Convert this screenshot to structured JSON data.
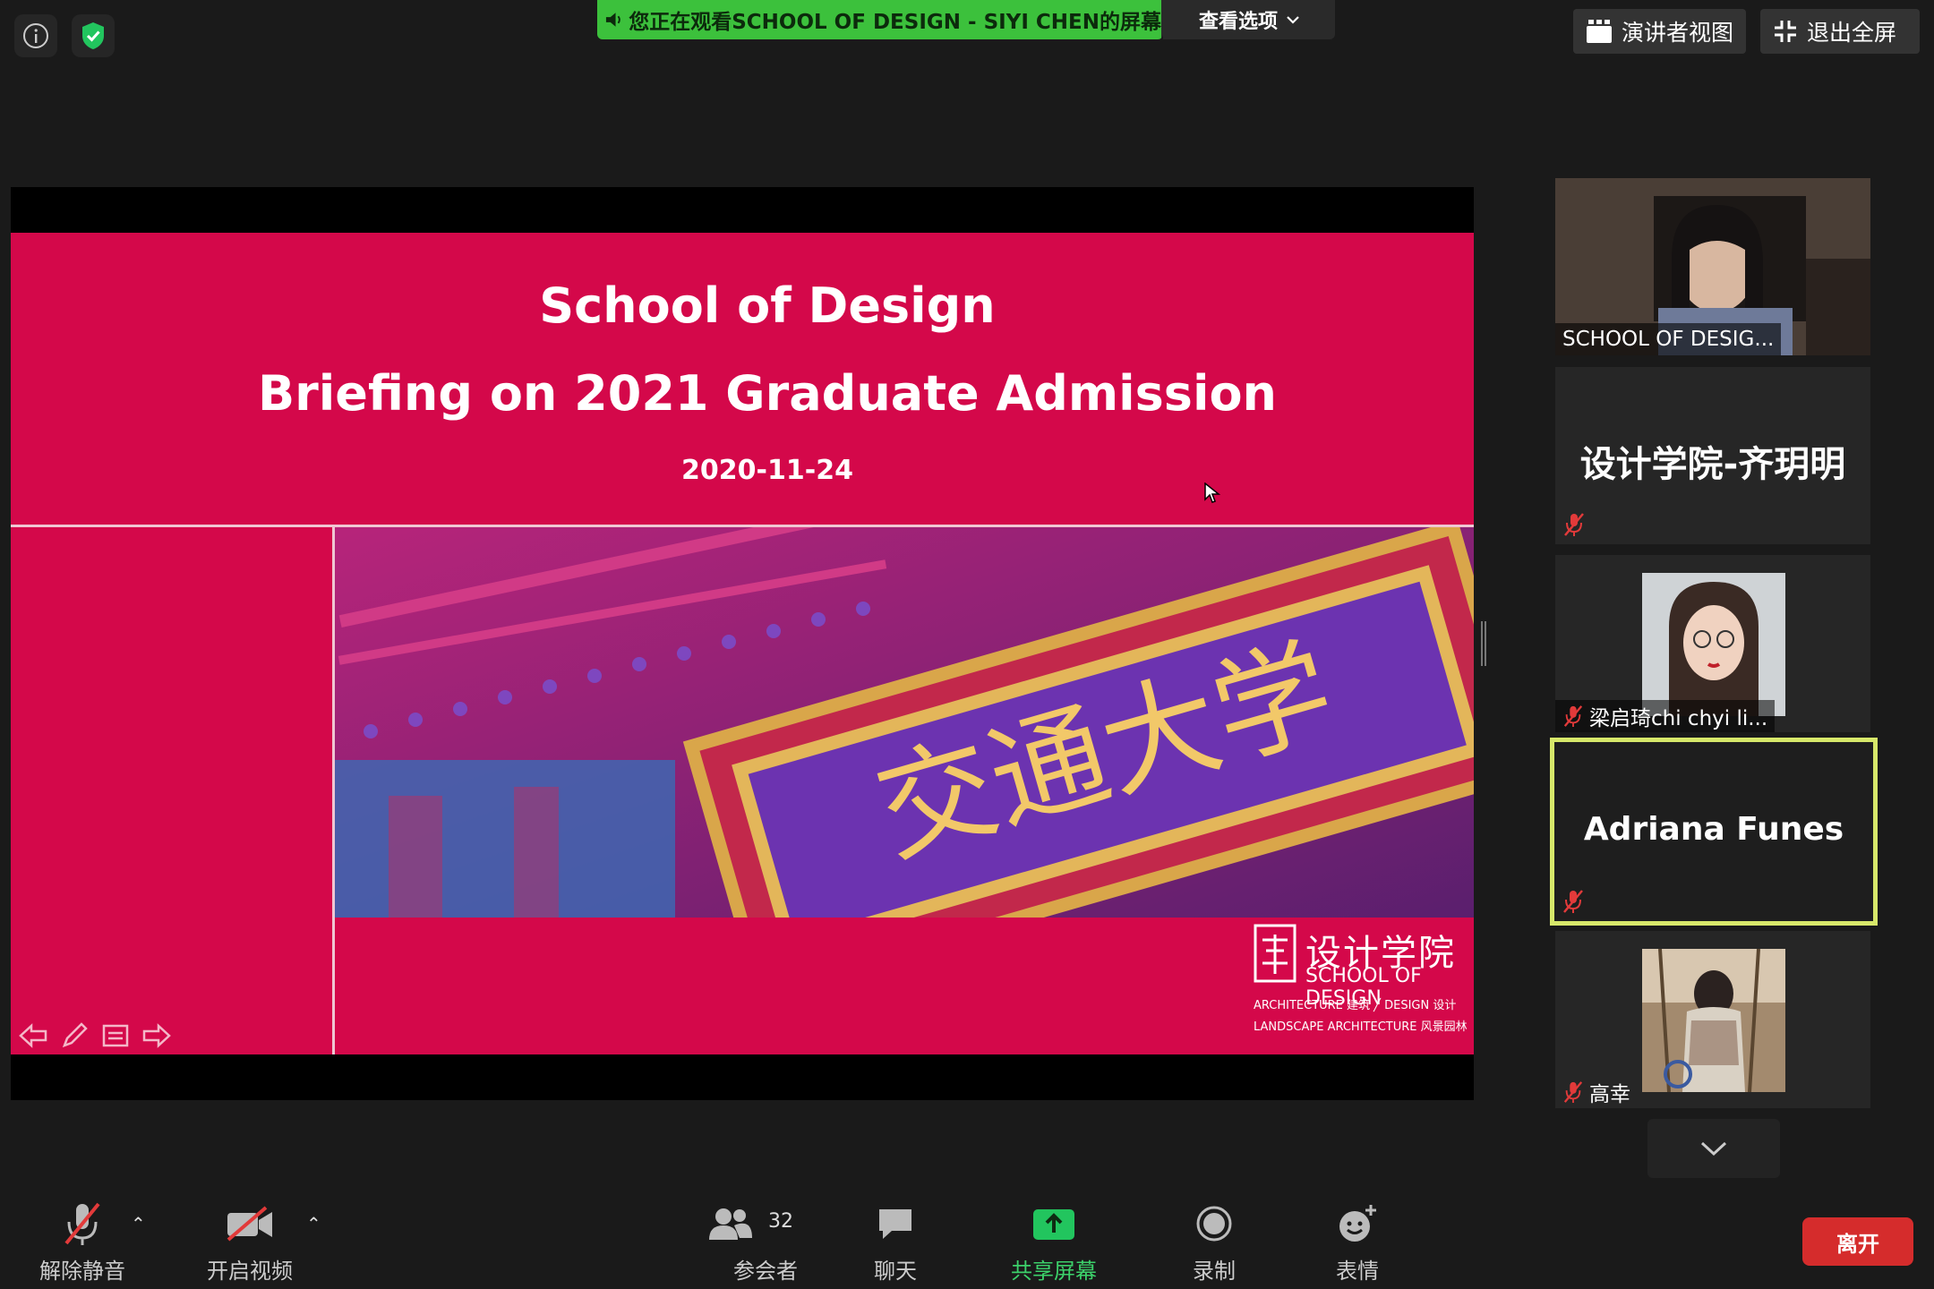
{
  "top": {
    "share_status": "您正在观看SCHOOL OF DESIGN - SIYI CHEN的屏幕",
    "view_options": "查看选项",
    "speaker_view": "演讲者视图",
    "exit_fullscreen": "退出全屏"
  },
  "slide": {
    "title_1": "School of Design",
    "title_2": "Briefing on 2021 Graduate Admission",
    "date": "2020-11-24",
    "logo_cn": "设计学院",
    "logo_en": "SCHOOL OF DESIGN",
    "logo_sub1": "ARCHITECTURE 建筑 ╱ DESIGN 设计",
    "logo_sub2": "LANDSCAPE ARCHITECTURE 风景园林",
    "photo_inscription": "交通大学"
  },
  "participants": [
    {
      "name": "SCHOOL OF DESIG..."
    },
    {
      "name": "设计学院-齐玥明"
    },
    {
      "name": "梁启琦chi chyi li..."
    },
    {
      "name": "Adriana Funes"
    },
    {
      "name": "高幸"
    }
  ],
  "toolbar": {
    "unmute": "解除静音",
    "start_video": "开启视频",
    "participants": "参会者",
    "participant_count": "32",
    "chat": "聊天",
    "share_screen": "共享屏幕",
    "record": "录制",
    "reactions": "表情",
    "leave": "离开"
  },
  "colors": {
    "share_green": "#3cc13c",
    "slide_red": "#d4084a",
    "active_speaker_border": "#d7e86a",
    "leave_red": "#d52c2c"
  }
}
